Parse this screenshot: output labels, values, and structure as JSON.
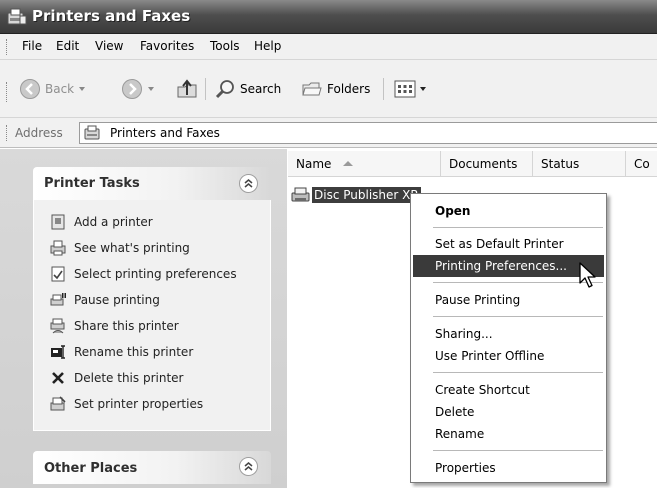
{
  "window": {
    "title": "Printers and Faxes",
    "icon": "printers-folder-icon"
  },
  "menubar": {
    "items": [
      "File",
      "Edit",
      "View",
      "Favorites",
      "Tools",
      "Help"
    ]
  },
  "toolbar": {
    "back_label": "Back",
    "search_label": "Search",
    "folders_label": "Folders",
    "icons": {
      "back": "back-arrow-icon",
      "forward": "forward-arrow-icon",
      "up": "up-folder-icon",
      "search": "search-icon",
      "folders": "folders-icon",
      "views": "views-icon"
    }
  },
  "address": {
    "label": "Address",
    "value": "Printers and Faxes"
  },
  "task_pane": {
    "printer_tasks": {
      "title": "Printer Tasks",
      "items": [
        {
          "label": "Add a printer",
          "icon": "add-printer-icon"
        },
        {
          "label": "See what's printing",
          "icon": "print-queue-icon"
        },
        {
          "label": "Select printing preferences",
          "icon": "preferences-icon"
        },
        {
          "label": "Pause printing",
          "icon": "pause-printer-icon"
        },
        {
          "label": "Share this printer",
          "icon": "share-printer-icon"
        },
        {
          "label": "Rename this printer",
          "icon": "rename-icon"
        },
        {
          "label": "Delete this printer",
          "icon": "delete-x-icon"
        },
        {
          "label": "Set printer properties",
          "icon": "properties-icon"
        }
      ]
    },
    "other_places": {
      "title": "Other Places"
    }
  },
  "list": {
    "columns": [
      "Name",
      "Documents",
      "Status",
      "Co"
    ],
    "items": [
      {
        "name": "Disc Publisher XR"
      }
    ]
  },
  "context_menu": {
    "items": [
      {
        "label": "Open",
        "bold": true
      },
      {
        "label": "Set as Default Printer"
      },
      {
        "label": "Printing Preferences...",
        "highlighted": true
      },
      {
        "label": "Pause Printing"
      },
      {
        "label": "Sharing..."
      },
      {
        "label": "Use Printer Offline"
      },
      {
        "label": "Create Shortcut"
      },
      {
        "label": "Delete"
      },
      {
        "label": "Rename"
      },
      {
        "label": "Properties"
      }
    ]
  },
  "colors": {
    "selection": "#3d3d3d",
    "titlebar": "#4e4e4e",
    "pane": "#d3d3d3"
  }
}
